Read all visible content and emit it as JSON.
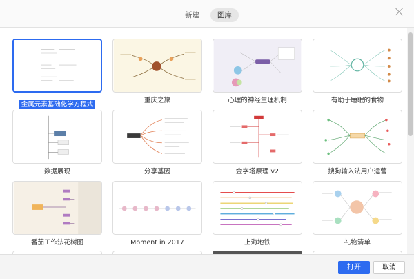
{
  "header": {
    "tabs": [
      {
        "label": "新建",
        "active": false
      },
      {
        "label": "图库",
        "active": true
      }
    ]
  },
  "templates": [
    {
      "label": "金属元素基础化学方程式",
      "selected": true
    },
    {
      "label": "重庆之旅",
      "selected": false
    },
    {
      "label": "心理的神经生理机制",
      "selected": false
    },
    {
      "label": "有助于睡眠的食物",
      "selected": false
    },
    {
      "label": "数据展现",
      "selected": false
    },
    {
      "label": "分享基因",
      "selected": false
    },
    {
      "label": "金字塔原理 v2",
      "selected": false
    },
    {
      "label": "搜狗输入法用户运营",
      "selected": false
    },
    {
      "label": "番茄工作法花树图",
      "selected": false
    },
    {
      "label": "Moment in 2017",
      "selected": false
    },
    {
      "label": "上海地铁",
      "selected": false
    },
    {
      "label": "礼物清单",
      "selected": false
    }
  ],
  "footer": {
    "open_label": "打开",
    "cancel_label": "取消"
  },
  "colors": {
    "accent": "#2d6bf0",
    "header_bg": "#fafafa",
    "footer_bg": "#f4f4f4"
  }
}
